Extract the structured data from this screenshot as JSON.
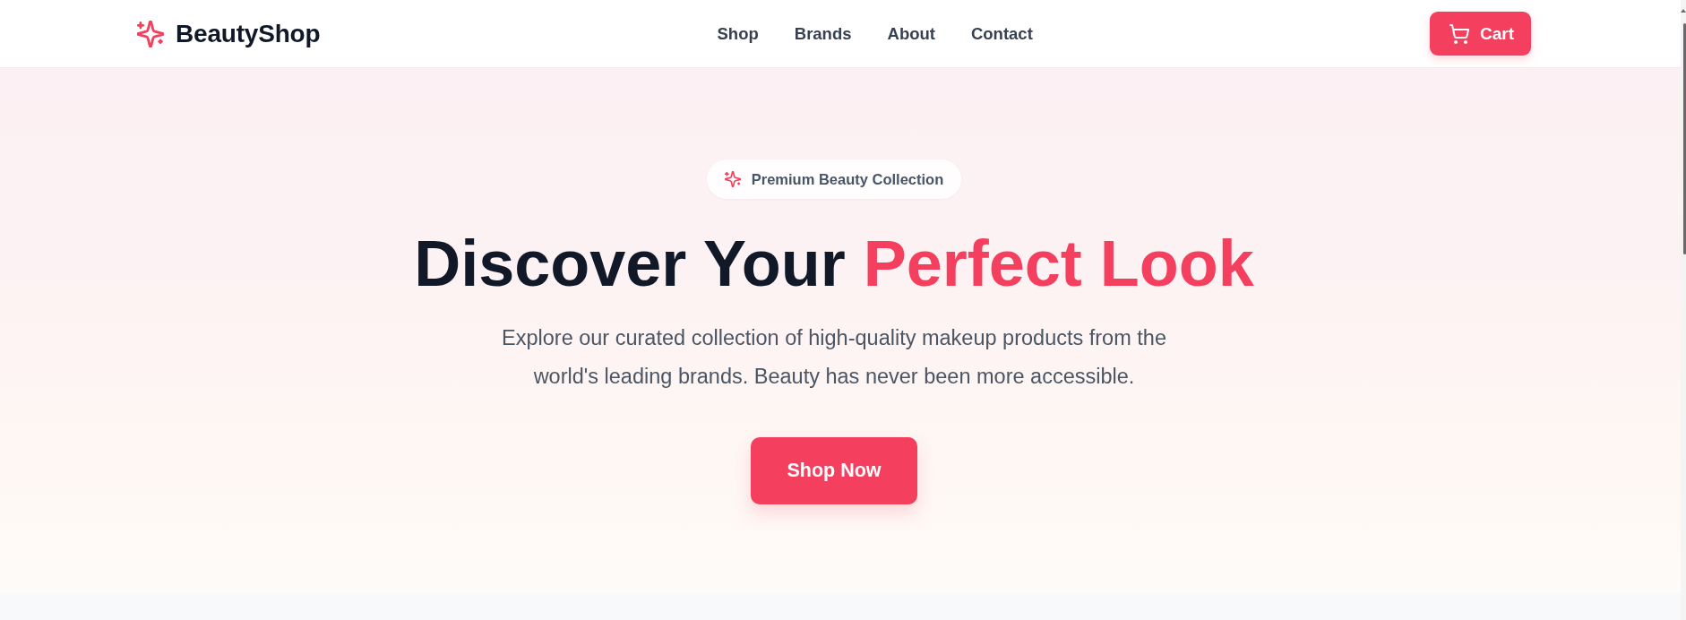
{
  "header": {
    "logo": "BeautyShop",
    "nav": [
      {
        "label": "Shop"
      },
      {
        "label": "Brands"
      },
      {
        "label": "About"
      },
      {
        "label": "Contact"
      }
    ],
    "cart_button": "Cart"
  },
  "hero": {
    "badge": "Premium Beauty Collection",
    "heading": "Discover Your",
    "heading_highlight": "Perfect Look",
    "description": "Explore our curated collection of high-quality makeup products from the world's leading brands. Beauty has never been more accessible.",
    "cta_button": "Shop Now"
  }
}
